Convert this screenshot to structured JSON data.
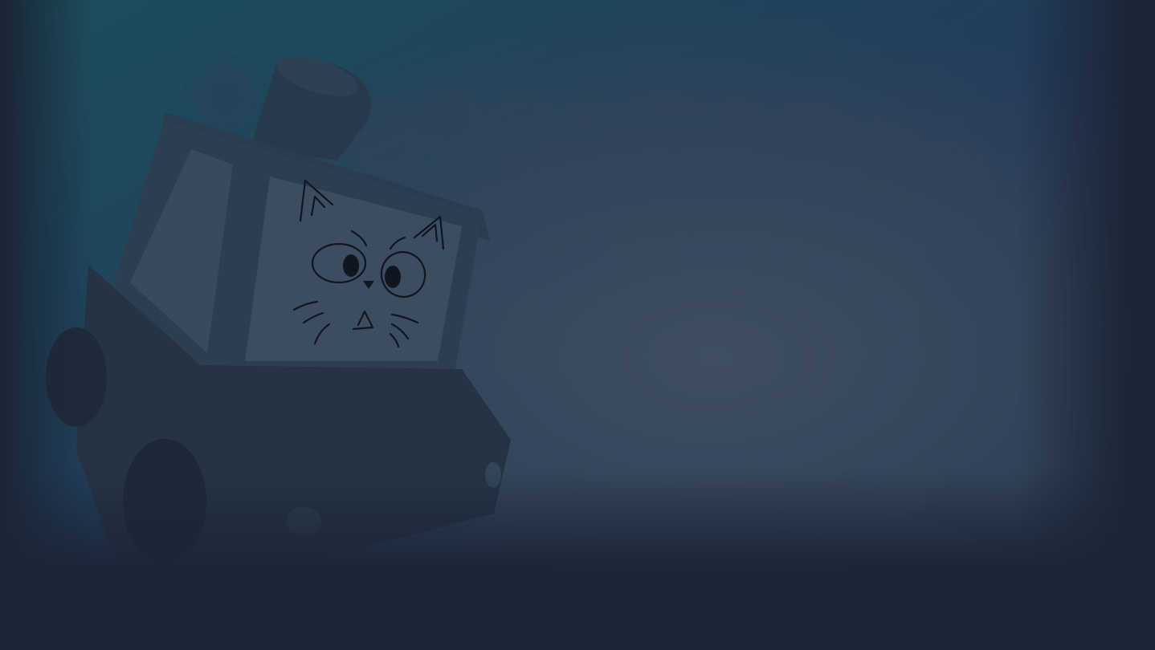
{
  "scene": {
    "subject": "cat-face-screen-vehicle",
    "colors": {
      "sky_top": "#1c4a5a",
      "sky_right": "#223657",
      "fog": "#3a4a5e",
      "vignette": "#1b2536",
      "vehicle_body": "#2b3a4b",
      "vehicle_dark": "#223042",
      "screen": "#3b4b5f",
      "outline": "#0f1620"
    }
  }
}
